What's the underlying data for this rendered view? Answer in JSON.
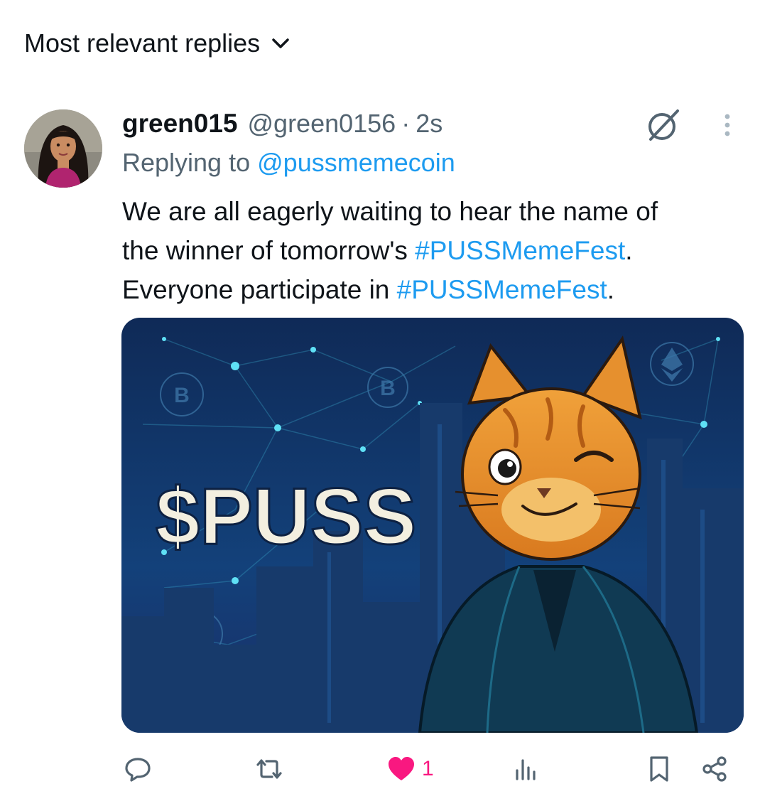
{
  "sort": {
    "label": "Most relevant replies"
  },
  "tweet": {
    "display_name": "green015",
    "handle": "@green0156",
    "separator": "·",
    "time": "2s",
    "replying_prefix": "Replying to",
    "replying_handle": "@pussmemecoin",
    "text_line1": "We are all eagerly waiting to hear the name of",
    "text_line2_prefix": "the winner of tomorrow's",
    "hashtag1": "#PUSSMemeFest",
    "text_line2_suffix": ".",
    "text_line3_prefix": "Everyone participate in",
    "hashtag2": "#PUSSMemeFest",
    "text_line3_suffix": ".",
    "media": {
      "headline": "$PUSS"
    }
  },
  "actions": {
    "reply_icon": "reply-icon",
    "retweet_icon": "retweet-icon",
    "like_icon": "heart-filled-icon",
    "like_count": "1",
    "views_icon": "views-icon",
    "bookmark_icon": "bookmark-icon",
    "share_icon": "share-icon"
  },
  "colors": {
    "link": "#1d9bf0",
    "like": "#f91880",
    "secondary_text": "#536471",
    "media_bg": "#12315f"
  }
}
